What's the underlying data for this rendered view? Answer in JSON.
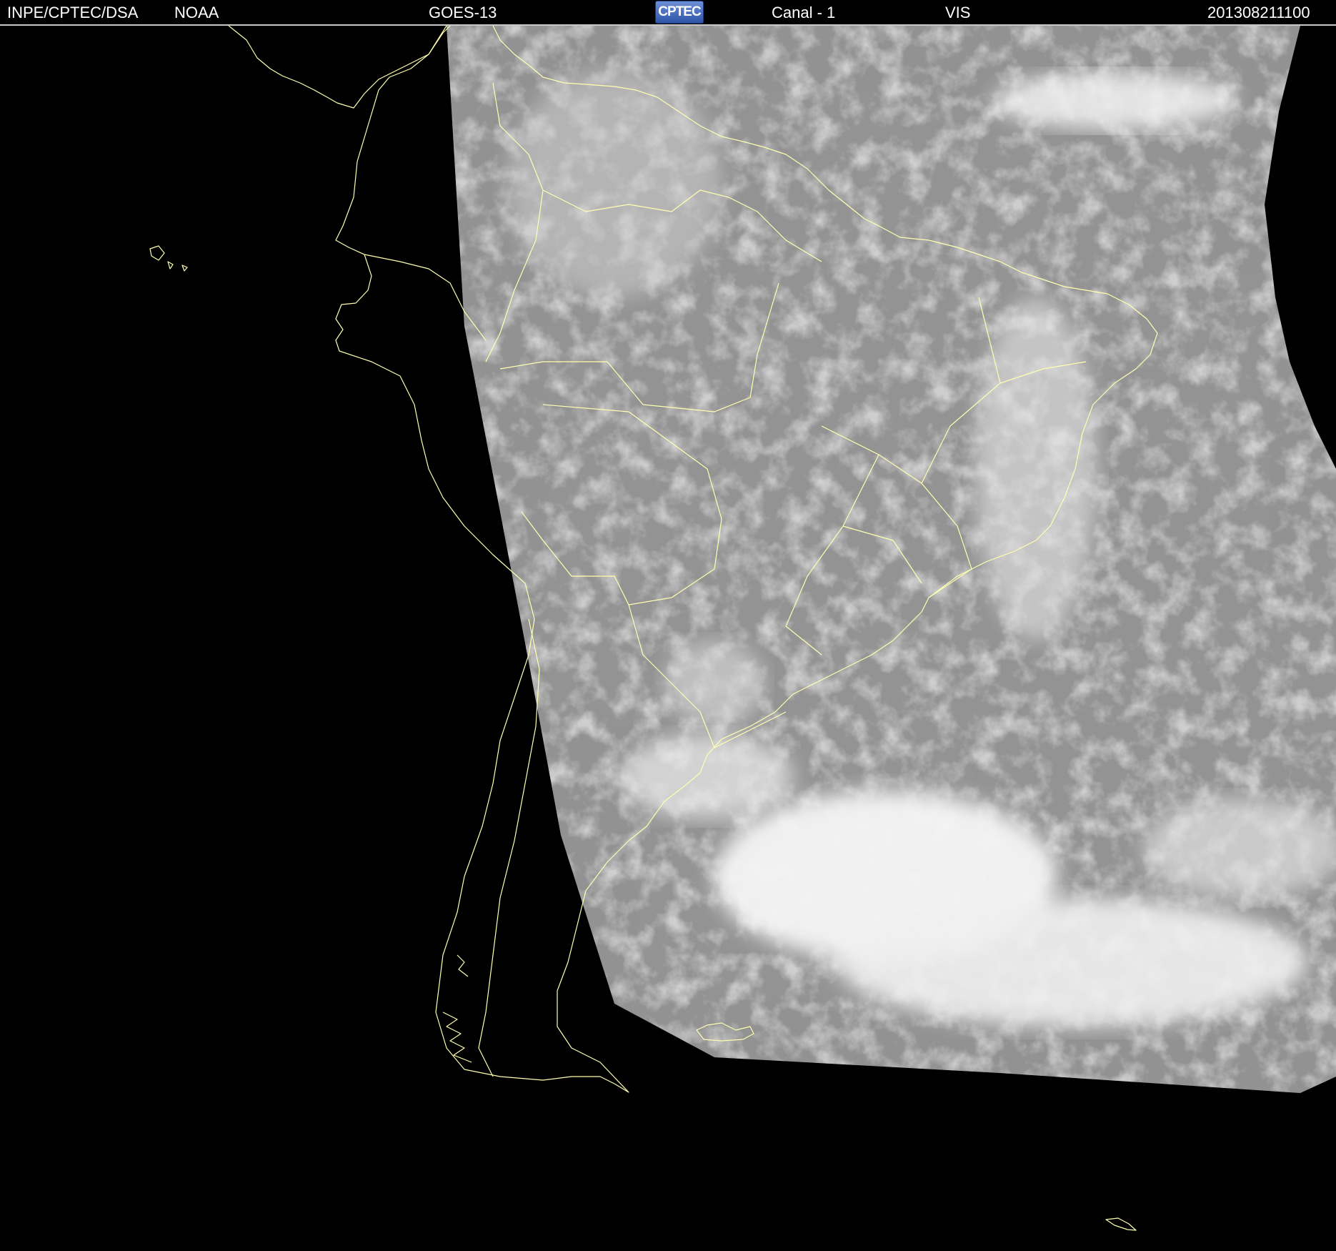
{
  "header": {
    "institution": "INPE/CPTEC/DSA",
    "agency": "NOAA",
    "satellite": "GOES-13",
    "logo_text": "CPTEC",
    "channel": "Canal - 1",
    "band": "VIS",
    "timestamp": "201308211100"
  },
  "colors": {
    "background": "#000000",
    "coastline": "#ffffb0",
    "header_text": "#ffffff",
    "cloud_bright": "#f2f2f2",
    "surface_gray": "#5a5a5a"
  },
  "map": {
    "region": "South America",
    "product": "visible satellite imagery"
  }
}
